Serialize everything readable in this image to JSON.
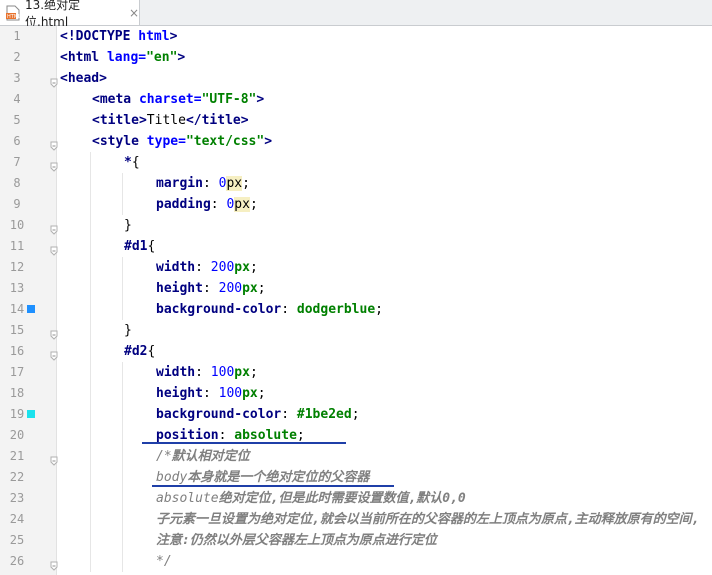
{
  "tab": {
    "title": "13.绝对定位.html",
    "close": "×",
    "icon": "html-file-icon"
  },
  "lines": [
    {
      "n": "1",
      "indent": 0,
      "tokens": [
        [
          "tag",
          "<!DOCTYPE "
        ],
        [
          "attr",
          "html"
        ],
        [
          "tag",
          ">"
        ]
      ]
    },
    {
      "n": "2",
      "indent": 0,
      "tokens": [
        [
          "tag",
          "<html "
        ],
        [
          "attr",
          "lang="
        ],
        [
          "str",
          "\"en\""
        ],
        [
          "tag",
          ">"
        ]
      ]
    },
    {
      "n": "3",
      "indent": 0,
      "tokens": [
        [
          "tag",
          "<head>"
        ]
      ]
    },
    {
      "n": "4",
      "indent": 1,
      "tokens": [
        [
          "tag",
          "<meta "
        ],
        [
          "attr",
          "charset="
        ],
        [
          "str",
          "\"UTF-8\""
        ],
        [
          "tag",
          ">"
        ]
      ]
    },
    {
      "n": "5",
      "indent": 1,
      "tokens": [
        [
          "tag",
          "<title>"
        ],
        [
          "plain",
          "Title"
        ],
        [
          "tag",
          "</title>"
        ]
      ]
    },
    {
      "n": "6",
      "indent": 1,
      "tokens": [
        [
          "tag",
          "<style "
        ],
        [
          "attr",
          "type="
        ],
        [
          "str",
          "\"text/css\""
        ],
        [
          "tag",
          ">"
        ]
      ]
    },
    {
      "n": "7",
      "indent": 2,
      "tokens": [
        [
          "sel",
          "*"
        ],
        [
          "plain",
          "{"
        ]
      ]
    },
    {
      "n": "8",
      "indent": 3,
      "tokens": [
        [
          "prop",
          "margin"
        ],
        [
          "plain",
          ": "
        ],
        [
          "num",
          "0"
        ],
        [
          "unitbg",
          "px"
        ],
        [
          "plain",
          ";"
        ]
      ]
    },
    {
      "n": "9",
      "indent": 3,
      "tokens": [
        [
          "prop",
          "padding"
        ],
        [
          "plain",
          ": "
        ],
        [
          "num",
          "0"
        ],
        [
          "unitbg",
          "px"
        ],
        [
          "plain",
          ";"
        ]
      ]
    },
    {
      "n": "10",
      "indent": 2,
      "tokens": [
        [
          "plain",
          "}"
        ]
      ]
    },
    {
      "n": "11",
      "indent": 2,
      "tokens": [
        [
          "sel",
          "#d1"
        ],
        [
          "plain",
          "{"
        ]
      ]
    },
    {
      "n": "12",
      "indent": 3,
      "tokens": [
        [
          "prop",
          "width"
        ],
        [
          "plain",
          ": "
        ],
        [
          "num",
          "200"
        ],
        [
          "unit",
          "px"
        ],
        [
          "plain",
          ";"
        ]
      ]
    },
    {
      "n": "13",
      "indent": 3,
      "tokens": [
        [
          "prop",
          "height"
        ],
        [
          "plain",
          ": "
        ],
        [
          "num",
          "200"
        ],
        [
          "unit",
          "px"
        ],
        [
          "plain",
          ";"
        ]
      ]
    },
    {
      "n": "14",
      "indent": 3,
      "tokens": [
        [
          "prop",
          "background-color"
        ],
        [
          "plain",
          ": "
        ],
        [
          "val",
          "dodgerblue"
        ],
        [
          "plain",
          ";"
        ]
      ],
      "marker": "#1e90ff"
    },
    {
      "n": "15",
      "indent": 2,
      "tokens": [
        [
          "plain",
          "}"
        ]
      ]
    },
    {
      "n": "16",
      "indent": 2,
      "tokens": [
        [
          "sel",
          "#d2"
        ],
        [
          "plain",
          "{"
        ]
      ]
    },
    {
      "n": "17",
      "indent": 3,
      "tokens": [
        [
          "prop",
          "width"
        ],
        [
          "plain",
          ": "
        ],
        [
          "num",
          "100"
        ],
        [
          "unit",
          "px"
        ],
        [
          "plain",
          ";"
        ]
      ]
    },
    {
      "n": "18",
      "indent": 3,
      "tokens": [
        [
          "prop",
          "height"
        ],
        [
          "plain",
          ": "
        ],
        [
          "num",
          "100"
        ],
        [
          "unit",
          "px"
        ],
        [
          "plain",
          ";"
        ]
      ]
    },
    {
      "n": "19",
      "indent": 3,
      "tokens": [
        [
          "prop",
          "background-color"
        ],
        [
          "plain",
          ": "
        ],
        [
          "val",
          "#1be2ed"
        ],
        [
          "plain",
          ";"
        ]
      ],
      "marker": "#1be2ed"
    },
    {
      "n": "20",
      "indent": 3,
      "tokens": [
        [
          "prop",
          "position"
        ],
        [
          "plain",
          ": "
        ],
        [
          "val",
          "absolute"
        ],
        [
          "plain",
          ";"
        ]
      ]
    },
    {
      "n": "21",
      "indent": 3,
      "tokens": [
        [
          "cm",
          "/*"
        ],
        [
          "cmb",
          "默认相对定位"
        ]
      ]
    },
    {
      "n": "22",
      "indent": 3,
      "tokens": [
        [
          "cm",
          "body"
        ],
        [
          "cmb",
          "本身就是一个绝对定位的父容器"
        ]
      ]
    },
    {
      "n": "23",
      "indent": 3,
      "tokens": [
        [
          "cm",
          "absolute"
        ],
        [
          "cmb",
          "绝对定位,但是此时需要设置数值,默认0,0"
        ]
      ]
    },
    {
      "n": "24",
      "indent": 3,
      "tokens": [
        [
          "cmb",
          "子元素一旦设置为绝对定位,就会以当前所在的父容器的左上顶点为原点,主动释放原有的空间,"
        ]
      ]
    },
    {
      "n": "25",
      "indent": 3,
      "tokens": [
        [
          "cmb",
          "注意:仍然以外层父容器左上顶点为原点进行定位"
        ]
      ]
    },
    {
      "n": "26",
      "indent": 3,
      "tokens": [
        [
          "cm",
          "*/"
        ]
      ]
    }
  ]
}
